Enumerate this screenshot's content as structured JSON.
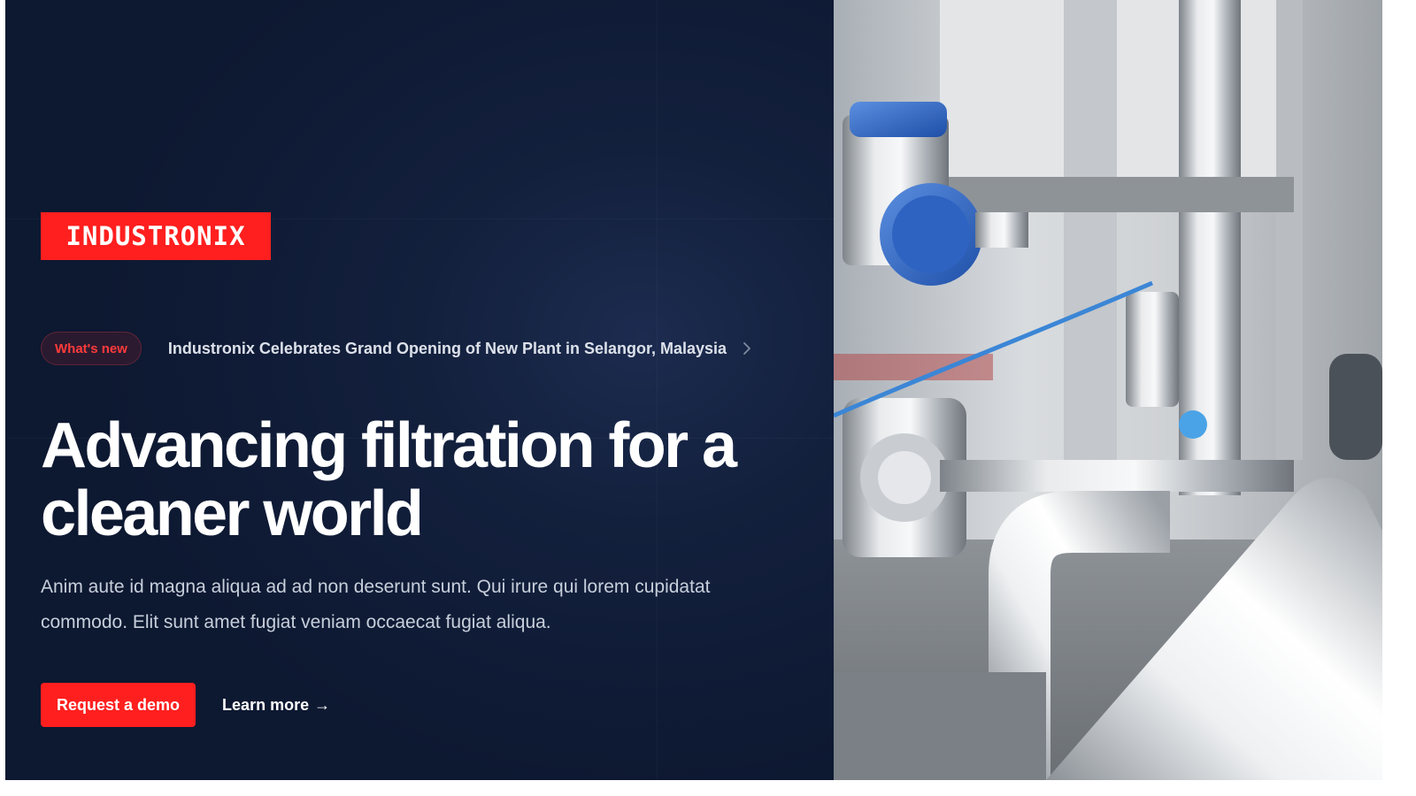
{
  "brand": {
    "logo_text": "INDUSTRONIX",
    "accent_color": "#ff1f1f",
    "background_color": "#0d1831"
  },
  "announcement": {
    "badge_label": "What's new",
    "text": "Industronix Celebrates Grand Opening of New Plant in Selangor, Malaysia",
    "icon": "chevron-right-icon"
  },
  "hero": {
    "headline": "Advancing filtration for a cleaner world",
    "description": "Anim aute id magna aliqua ad ad non deserunt sunt. Qui irure qui lorem cupidatat commodo. Elit sunt amet fugiat veniam occaecat fugiat aliqua."
  },
  "actions": {
    "primary_label": "Request a demo",
    "secondary_label": "Learn more",
    "secondary_icon": "arrow-right-icon"
  },
  "image": {
    "subject": "industrial-filtration-equipment-photo"
  }
}
